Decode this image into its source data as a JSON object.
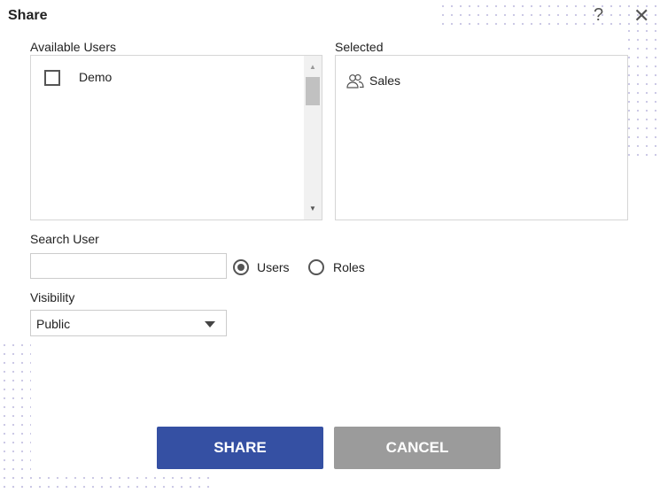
{
  "dialog": {
    "title": "Share"
  },
  "available": {
    "label": "Available Users",
    "items": [
      {
        "name": "Demo",
        "checked": false
      }
    ]
  },
  "selected": {
    "label": "Selected",
    "items": [
      {
        "name": "Sales",
        "icon": "users-group-icon"
      }
    ]
  },
  "search": {
    "label": "Search User",
    "value": "",
    "placeholder": "",
    "options": [
      "Users",
      "Roles"
    ],
    "selected": "Users"
  },
  "visibility": {
    "label": "Visibility",
    "value": "Public"
  },
  "buttons": {
    "share": "SHARE",
    "cancel": "CANCEL"
  },
  "colors": {
    "primary": "#3550a3",
    "cancel": "#9b9b9b"
  }
}
